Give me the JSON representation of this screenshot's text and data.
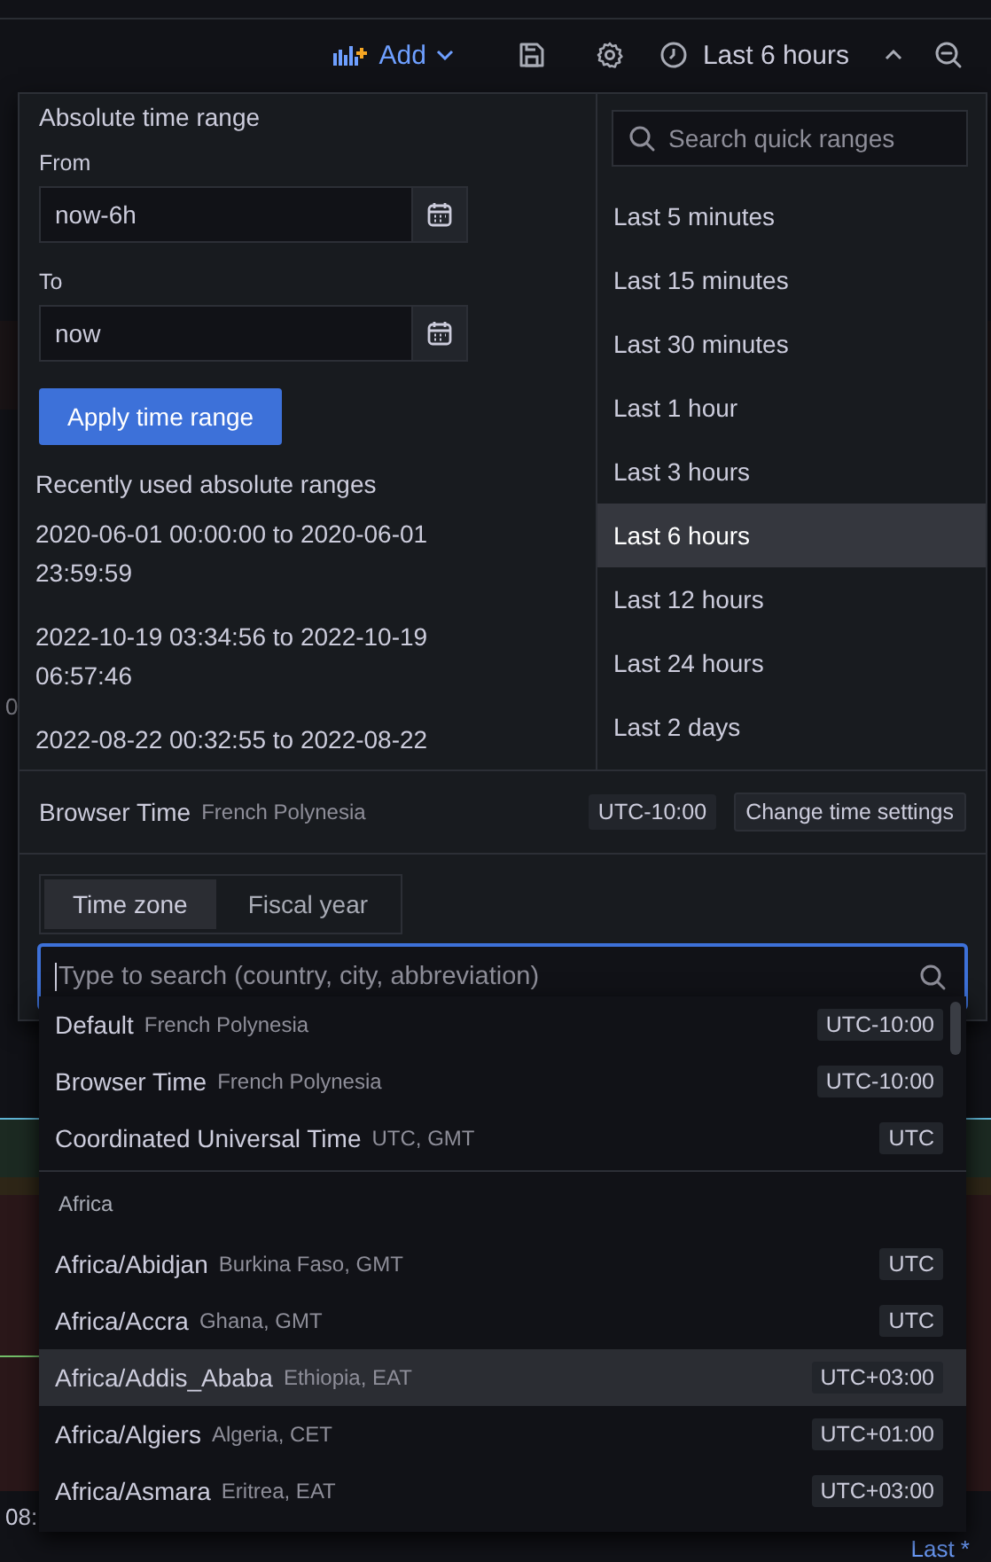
{
  "toolbar": {
    "add_label": "Add",
    "time_range": "Last 6 hours"
  },
  "absolute_range": {
    "title": "Absolute time range",
    "from_label": "From",
    "from_value": "now-6h",
    "to_label": "To",
    "to_value": "now",
    "apply_button": "Apply time range",
    "recent_title": "Recently used absolute ranges",
    "recent": [
      "2020-06-01 00:00:00 to 2020-06-01 23:59:59",
      "2022-10-19 03:34:56 to 2022-10-19 06:57:46",
      "2022-08-22 00:32:55 to 2022-08-22"
    ]
  },
  "quick_ranges": {
    "placeholder": "Search quick ranges",
    "items": [
      {
        "label": "Last 5 minutes",
        "selected": false
      },
      {
        "label": "Last 15 minutes",
        "selected": false
      },
      {
        "label": "Last 30 minutes",
        "selected": false
      },
      {
        "label": "Last 1 hour",
        "selected": false
      },
      {
        "label": "Last 3 hours",
        "selected": false
      },
      {
        "label": "Last 6 hours",
        "selected": true
      },
      {
        "label": "Last 12 hours",
        "selected": false
      },
      {
        "label": "Last 24 hours",
        "selected": false
      },
      {
        "label": "Last 2 days",
        "selected": false
      }
    ]
  },
  "time_settings": {
    "name": "Browser Time",
    "region": "French Polynesia",
    "offset": "UTC-10:00",
    "button": "Change time settings"
  },
  "tabs": [
    {
      "label": "Time zone",
      "selected": true
    },
    {
      "label": "Fiscal year",
      "selected": false
    }
  ],
  "timezone_search": {
    "placeholder": "Type to search (country, city, abbreviation)"
  },
  "timezones": [
    {
      "kind": "zone",
      "name": "Default",
      "detail": "French Polynesia",
      "offset": "UTC-10:00",
      "selected": false
    },
    {
      "kind": "zone",
      "name": "Browser Time",
      "detail": "French Polynesia",
      "offset": "UTC-10:00",
      "selected": false
    },
    {
      "kind": "zone",
      "name": "Coordinated Universal Time",
      "detail": "UTC, GMT",
      "offset": "UTC",
      "selected": false
    },
    {
      "kind": "group",
      "label": "Africa"
    },
    {
      "kind": "zone",
      "name": "Africa/Abidjan",
      "detail": "Burkina Faso, GMT",
      "offset": "UTC",
      "selected": false
    },
    {
      "kind": "zone",
      "name": "Africa/Accra",
      "detail": "Ghana, GMT",
      "offset": "UTC",
      "selected": false
    },
    {
      "kind": "zone",
      "name": "Africa/Addis_Ababa",
      "detail": "Ethiopia, EAT",
      "offset": "UTC+03:00",
      "selected": true
    },
    {
      "kind": "zone",
      "name": "Africa/Algiers",
      "detail": "Algeria, CET",
      "offset": "UTC+01:00",
      "selected": false
    },
    {
      "kind": "zone",
      "name": "Africa/Asmara",
      "detail": "Eritrea, EAT",
      "offset": "UTC+03:00",
      "selected": false
    }
  ],
  "background": {
    "tick": "0",
    "axis_label": "08:",
    "link": "Last *"
  }
}
